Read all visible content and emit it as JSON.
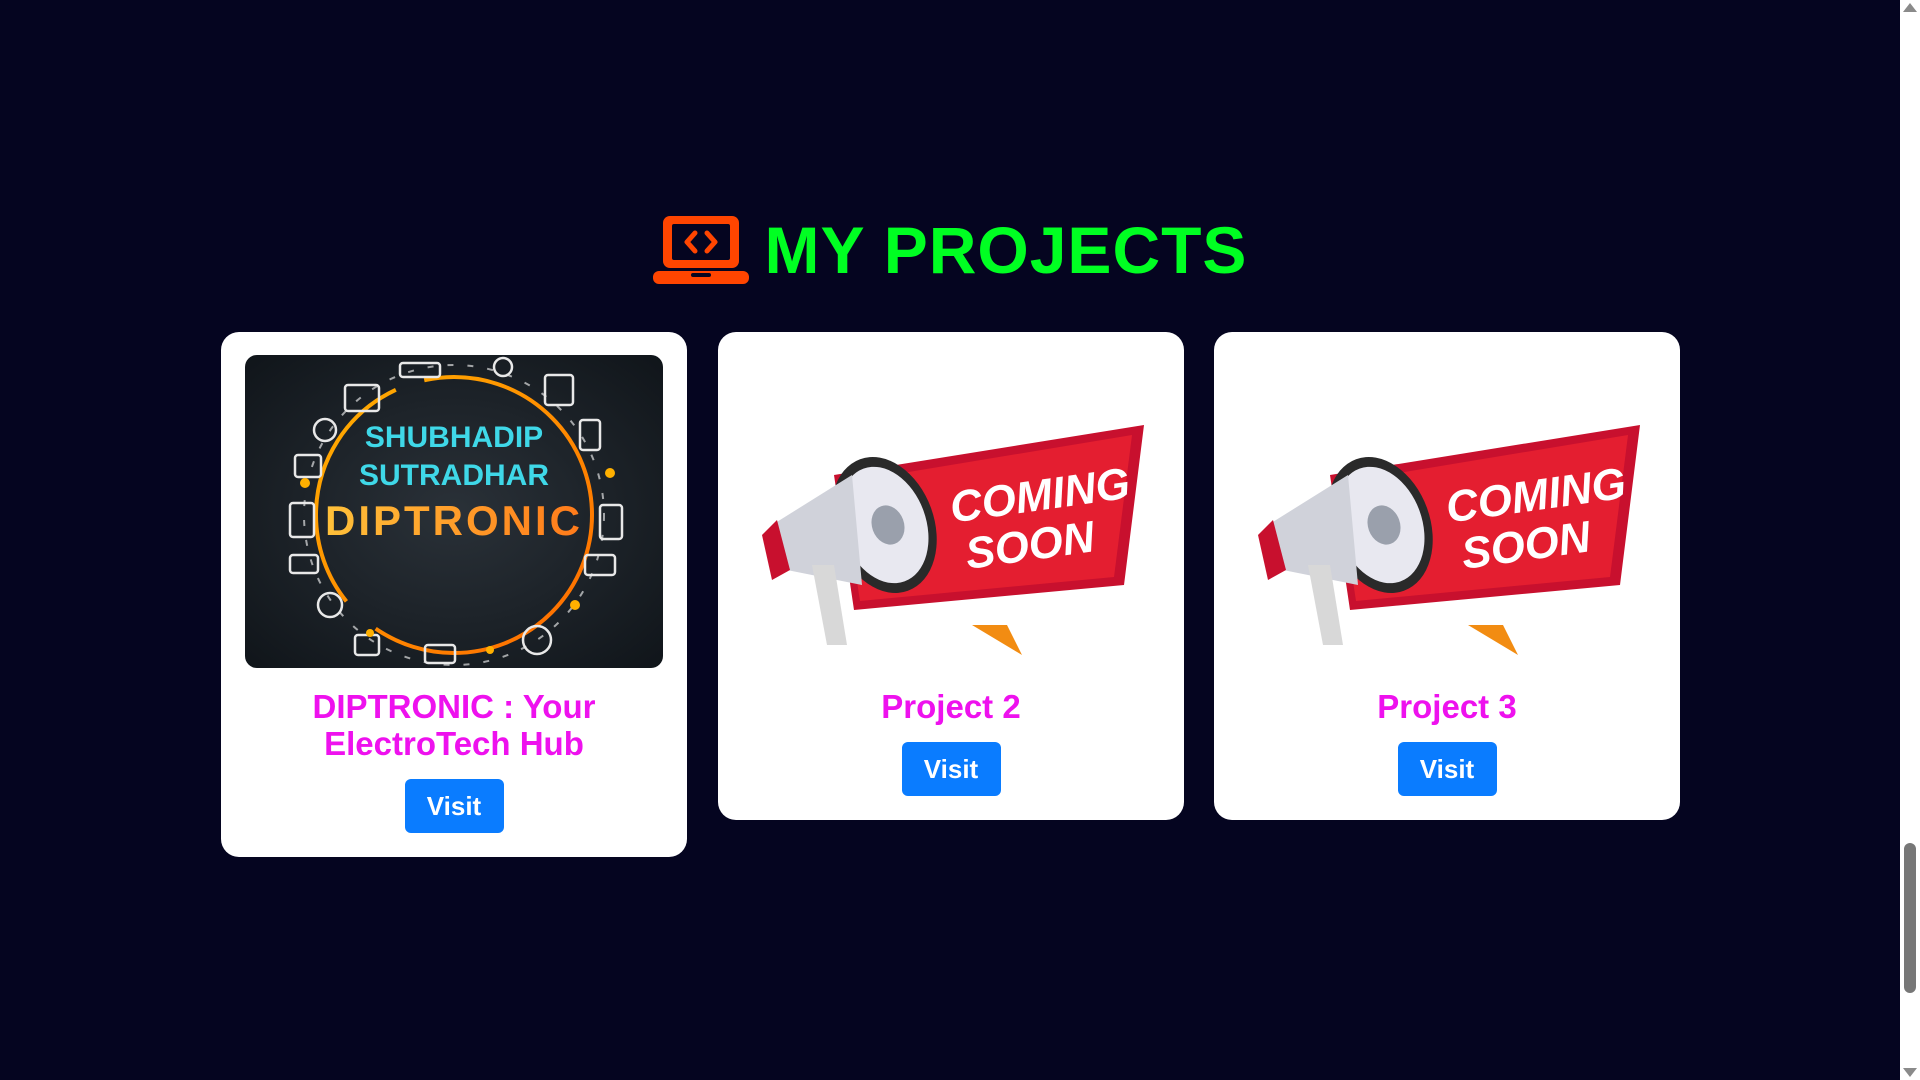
{
  "section": {
    "title": "MY PROJECTS",
    "icon": "laptop-code-icon",
    "title_color": "#00ff22",
    "icon_color": "#ff4500"
  },
  "projects": [
    {
      "title": "DIPTRONIC : Your ElectroTech Hub",
      "button_label": "Visit",
      "image": {
        "kind": "logo",
        "line1": "SHUBHADIP",
        "line2": "SUTRADHAR",
        "brand": "DIPTRONIC"
      }
    },
    {
      "title": "Project 2",
      "button_label": "Visit",
      "image": {
        "kind": "coming-soon",
        "line1": "COMING",
        "line2": "SOON"
      }
    },
    {
      "title": "Project 3",
      "button_label": "Visit",
      "image": {
        "kind": "coming-soon",
        "line1": "COMING",
        "line2": "SOON"
      }
    }
  ],
  "colors": {
    "background": "#050520",
    "card_title": "#ee11ee",
    "button": "#0a7cff"
  }
}
